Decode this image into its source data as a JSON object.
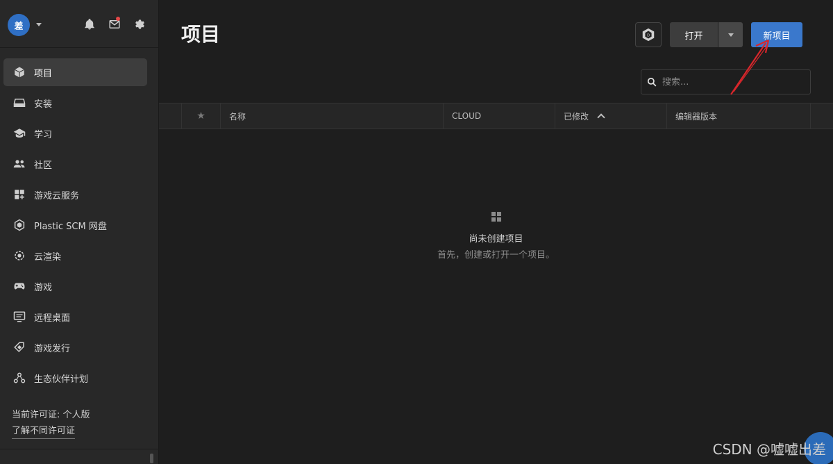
{
  "user": {
    "avatar_text": "差"
  },
  "sidebar": {
    "items": [
      {
        "label": "项目",
        "icon": "cube-icon"
      },
      {
        "label": "安装",
        "icon": "drive-icon"
      },
      {
        "label": "学习",
        "icon": "graduation-cap-icon"
      },
      {
        "label": "社区",
        "icon": "people-icon"
      },
      {
        "label": "游戏云服务",
        "icon": "grid-plus-icon"
      },
      {
        "label": "Plastic SCM 网盘",
        "icon": "plastic-icon"
      },
      {
        "label": "云渲染",
        "icon": "render-icon"
      },
      {
        "label": "游戏",
        "icon": "gamepad-icon"
      },
      {
        "label": "远程桌面",
        "icon": "monitor-icon"
      },
      {
        "label": "游戏发行",
        "icon": "tag-icon"
      },
      {
        "label": "生态伙伴计划",
        "icon": "partners-icon"
      }
    ],
    "license_text": "当前许可证: 个人版",
    "license_link": "了解不同许可证"
  },
  "main": {
    "title": "项目",
    "open_label": "打开",
    "new_label": "新项目",
    "search_placeholder": "搜索...",
    "columns": {
      "name": "名称",
      "cloud": "CLOUD",
      "modified": "已修改",
      "editor_version": "编辑器版本"
    },
    "empty_title": "尚未创建项目",
    "empty_sub": "首先，创建或打开一个项目。"
  },
  "watermark": "CSDN @嘘嘘出差",
  "colors": {
    "accent": "#3a78cc",
    "arrow": "#d9262b"
  }
}
